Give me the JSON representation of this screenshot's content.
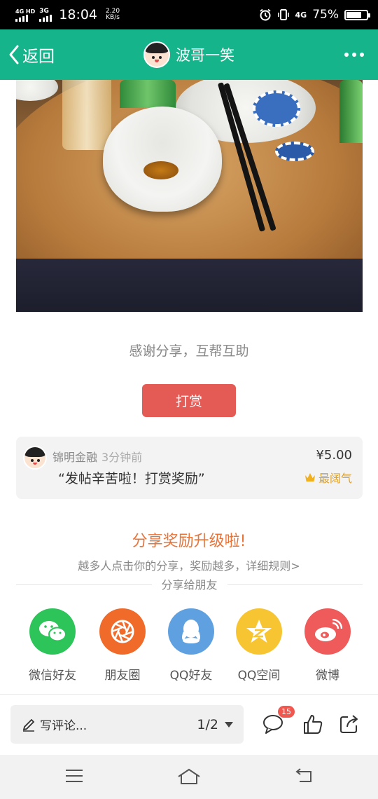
{
  "status_bar": {
    "network_1": "4G HD",
    "network_2": "3G",
    "time": "18:04",
    "speed_value": "2.20",
    "speed_unit": "KB/s",
    "network_right": "4G",
    "battery": "75%",
    "battery_level": 0.75
  },
  "nav": {
    "back_label": "返回",
    "title": "波哥一笑"
  },
  "post": {
    "thanks_text": "感谢分享，互帮互助",
    "tip_button": "打赏"
  },
  "tip_record": {
    "user": "锦明金融",
    "time": "3分钟前",
    "message": "“发帖辛苦啦！打赏奖励”",
    "amount": "¥5.00",
    "badge": "最阔气"
  },
  "share": {
    "title": "分享奖励升级啦!",
    "subtitle": "越多人点击你的分享，奖励越多，详细规则>",
    "friends_label": "分享给朋友",
    "targets": [
      {
        "label": "微信好友",
        "icon": "wechat-icon",
        "color": "#2dc45a"
      },
      {
        "label": "朋友圈",
        "icon": "moments-icon",
        "color": "#f06a2a"
      },
      {
        "label": "QQ好友",
        "icon": "qq-icon",
        "color": "#5fa0e0"
      },
      {
        "label": "QQ空间",
        "icon": "qzone-icon",
        "color": "#f7c432"
      },
      {
        "label": "微博",
        "icon": "weibo-icon",
        "color": "#ef5a5a"
      }
    ]
  },
  "bottom_bar": {
    "comment_placeholder": "写评论...",
    "page_indicator": "1/2",
    "comment_count": "15"
  },
  "colors": {
    "nav_bg": "#16b48b",
    "tip_button": "#e45a55",
    "share_title": "#e8743a"
  }
}
